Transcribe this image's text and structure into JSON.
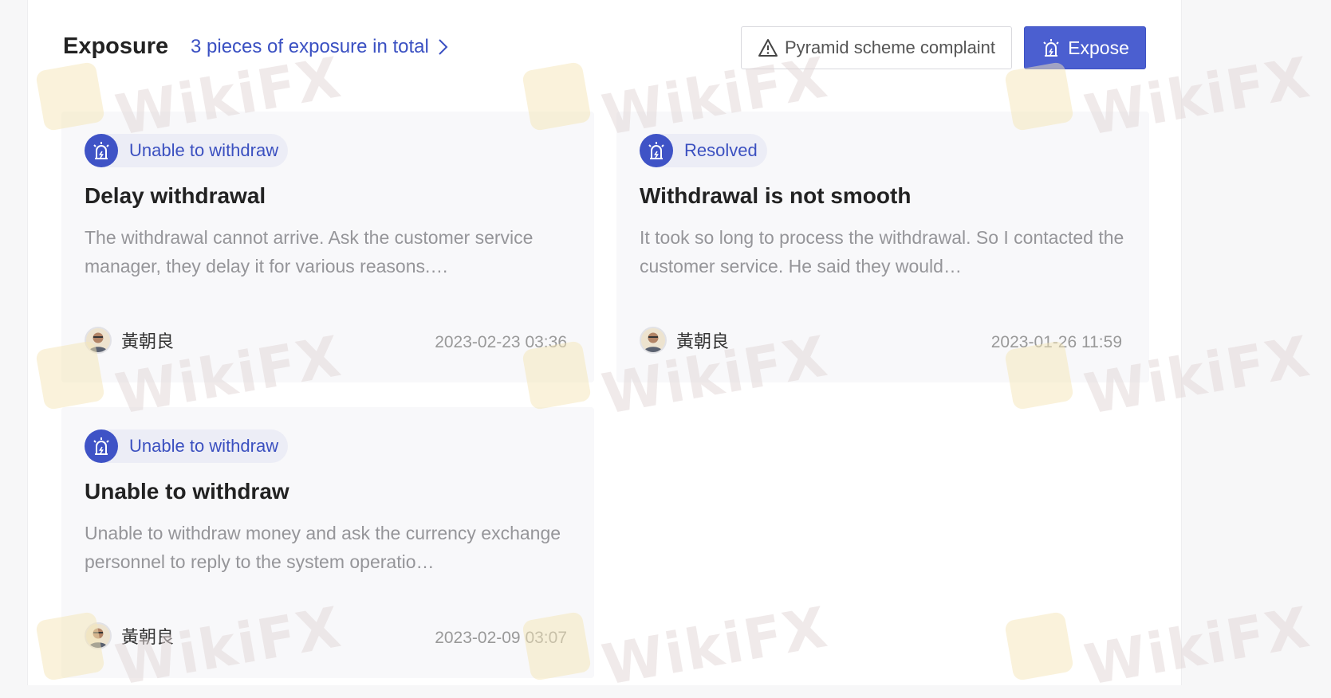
{
  "header": {
    "title": "Exposure",
    "total_link": "3 pieces of exposure in total",
    "complaint_button": "Pyramid scheme complaint",
    "expose_button": "Expose"
  },
  "cards": [
    {
      "badge": "Unable to withdraw",
      "title": "Delay withdrawal",
      "description": "The withdrawal cannot arrive. Ask the customer service manager, they delay it for various reasons.…",
      "author": "黃朝良",
      "date": "2023-02-23 03:36"
    },
    {
      "badge": "Resolved",
      "title": "Withdrawal is not smooth",
      "description": "It took so long to process the withdrawal. So I contacted the customer service. He said they would…",
      "author": "黃朝良",
      "date": "2023-01-26 11:59"
    },
    {
      "badge": "Unable to withdraw",
      "title": "Unable to withdraw",
      "description": "Unable to withdraw money and ask the currency exchange personnel to reply to the system operatio…",
      "author": "黃朝良",
      "date": "2023-02-09 03:07"
    }
  ],
  "watermark": {
    "text": "WikiFX"
  },
  "colors": {
    "accent": "#4b5fd0",
    "badge_bg": "#ecedf6",
    "card_bg": "#f8f8fa"
  }
}
